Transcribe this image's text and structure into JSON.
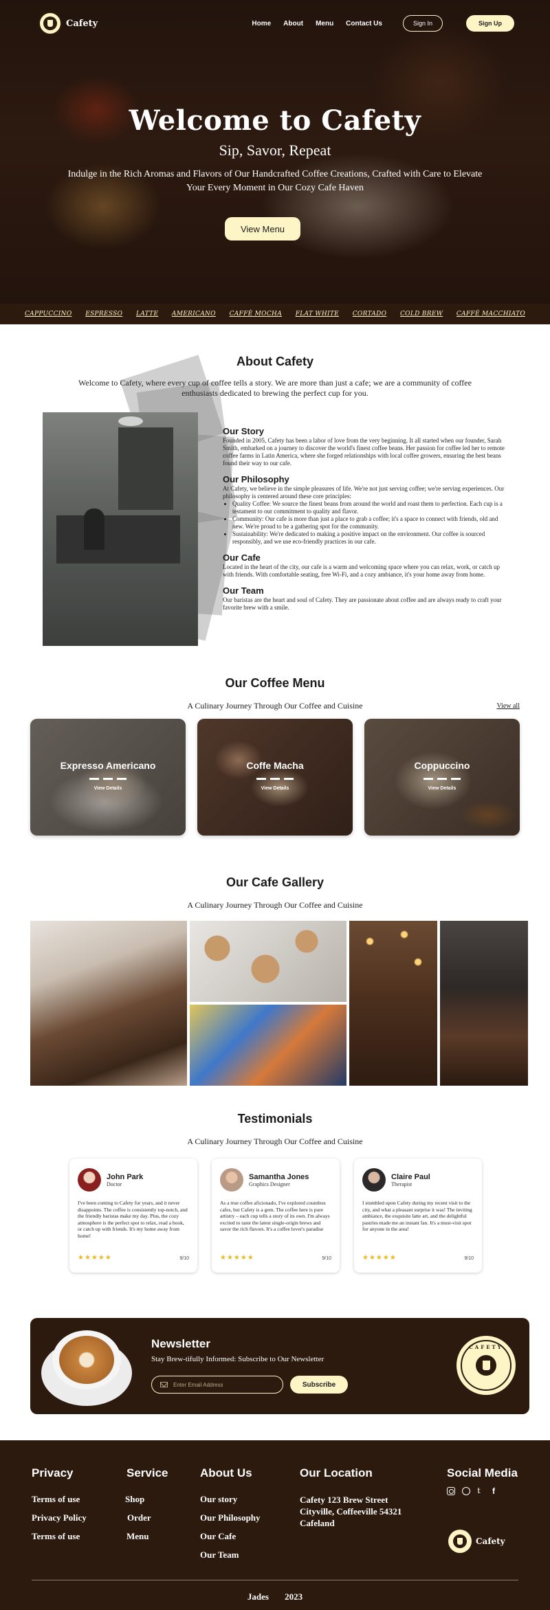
{
  "nav": {
    "brand": "Cafety",
    "links": [
      "Home",
      "About",
      "Menu",
      "Contact Us"
    ],
    "sign_in": "Sign In",
    "sign_up": "Sign Up"
  },
  "hero": {
    "title": "Welcome to Cafety",
    "subtitle": "Sip, Savor, Repeat",
    "description": "Indulge in the Rich Aromas and Flavors of Our Handcrafted Coffee Creations, Crafted with Care to Elevate Your Every Moment in Our Cozy Cafe Haven",
    "button": "View Menu"
  },
  "ticker": [
    "CAPPUCCINO",
    "ESPRESSO",
    "LATTE",
    "AMERICANO",
    "CAFFÈ MOCHA",
    "FLAT WHITE",
    "CORTADO",
    "COLD BREW",
    "CAFFÈ MACCHIATO"
  ],
  "about": {
    "title": "About Cafety",
    "intro": "Welcome to Cafety, where every cup of coffee tells a story. We are more than just a cafe; we are a community of coffee enthusiasts dedicated to brewing the perfect cup for you.",
    "story_title": "Our Story",
    "story": "Founded in 2005, Cafety has been a labor of love from the very beginning. It all started when our founder, Sarah Smith, embarked on a journey to discover the world's finest coffee beans. Her passion for coffee led her to remote coffee farms in Latin America, where she forged relationships with local coffee growers, ensuring the best beans found their way to our cafe.",
    "philosophy_title": "Our Philosophy",
    "philosophy": "At Cafety, we believe in the simple pleasures of life. We're not just serving coffee; we're serving experiences. Our philosophy is centered around these core principles:",
    "principles": [
      "Quality Coffee: We source the finest beans from around the world and roast them to perfection. Each cup is a testament to our commitment to quality and flavor.",
      "Community: Our cafe is more than just a place to grab a coffee; it's a space to connect with friends, old and new. We're proud to be a gathering spot for the community.",
      "Sustainability: We're dedicated to making a positive impact on the environment. Our coffee is sourced responsibly, and we use eco-friendly practices in our cafe."
    ],
    "cafe_title": "Our Cafe",
    "cafe": "Located in the heart of the city, our cafe is a warm and welcoming space where you can relax, work, or catch up with friends. With comfortable seating, free Wi-Fi, and a cozy ambiance, it's your home away from home.",
    "team_title": "Our Team",
    "team": "Our baristas are the heart and soul of Cafety. They are passionate about coffee and are always ready to craft your favorite brew with a smile."
  },
  "menu": {
    "title": "Our Coffee Menu",
    "subtitle": "A Culinary Journey Through Our Coffee and Cuisine",
    "view_all": "View all",
    "cards": [
      {
        "name": "Expresso Americano",
        "details": "View Details"
      },
      {
        "name": "Coffe Macha",
        "details": "View Details"
      },
      {
        "name": "Coppuccino",
        "details": "View Details"
      }
    ]
  },
  "gallery": {
    "title": "Our Cafe Gallery",
    "subtitle": "A Culinary Journey Through Our Coffee and Cuisine"
  },
  "testimonials": {
    "title": "Testimonials",
    "subtitle": "A Culinary Journey Through Our Coffee and Cuisine",
    "items": [
      {
        "name": "John Park",
        "role": "Doctor",
        "text": "I've been coming to Cafety for years, and it never disappoints. The coffee is consistently top-notch, and the friendly baristas make my day. Plus, the cozy atmosphere is the perfect spot to relax, read a book, or catch up with friends. It's my home away from home!",
        "stars": "★★★★★",
        "score": "9/10"
      },
      {
        "name": "Samantha Jones",
        "role": "Graphics Designer",
        "text": "As a true coffee aficionado, I've explored countless cafes, but Cafety is a gem. The coffee here is pure artistry – each cup tells a story of its own. I'm always excited to taste the latest single-origin brews and savor the rich flavors. It's a coffee lover's paradise",
        "stars": "★★★★★",
        "score": "9/10"
      },
      {
        "name": "Claire Paul",
        "role": "Therapist",
        "text": "I stumbled upon Cafety during my recent visit to the city, and what a pleasant surprise it was! The inviting ambiance, the exquisite latte art, and the delightful pastries made me an instant fan. It's a must-visit spot for anyone in the area!",
        "stars": "★★★★★",
        "score": "9/10"
      }
    ]
  },
  "newsletter": {
    "title": "Newsletter",
    "subtitle": "Stay Brew-tifully Informed: Subscribe to Our Newsletter",
    "placeholder": "Enter Email Address",
    "button": "Subscribe",
    "badge": "CAFETY"
  },
  "footer": {
    "privacy_title": "Privacy",
    "privacy_links": [
      "Terms of use",
      "Privacy Policy",
      "Terms of use"
    ],
    "service_title": "Service",
    "service_links": [
      "Shop",
      "Order",
      "Menu"
    ],
    "about_title": "About Us",
    "about_links": [
      "Our story",
      "Our Philosophy",
      "Our Cafe",
      "Our Team"
    ],
    "location_title": "Our Location",
    "location_lines": [
      "Cafety 123 Brew Street",
      "Cityville, Coffeeville 54321",
      "Cafeland"
    ],
    "social_title": "Social Media",
    "brand": "Cafety",
    "copyright_name": "Jades",
    "copyright_year": "2023"
  },
  "colors": {
    "brown": "#2b1a0d",
    "cream": "#fdf5c6",
    "star": "#e8b923"
  }
}
